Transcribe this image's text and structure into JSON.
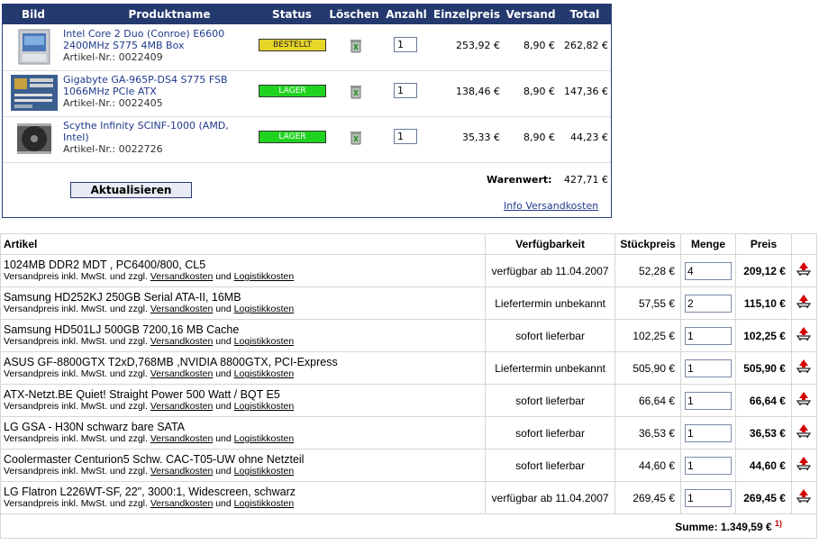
{
  "cart1": {
    "headers": [
      "Bild",
      "Produktname",
      "Status",
      "Löschen",
      "Anzahl",
      "Einzelpreis",
      "Versand",
      "Total"
    ],
    "rows": [
      {
        "name": "Intel Core 2 Duo (Conroe) E6600 2400MHz S775 4MB Box",
        "artnr": "Artikel-Nr.: 0022409",
        "status": "BESTELLT",
        "qty": "1",
        "price": "253,92 €",
        "shipping": "8,90 €",
        "total": "262,82 €"
      },
      {
        "name": "Gigabyte GA-965P-DS4 S775 FSB 1066MHz PCIe ATX",
        "artnr": "Artikel-Nr.: 0022405",
        "status": "LAGER",
        "qty": "1",
        "price": "138,46 €",
        "shipping": "8,90 €",
        "total": "147,36 €"
      },
      {
        "name": "Scythe Infinity SCINF-1000 (AMD, Intel)",
        "artnr": "Artikel-Nr.: 0022726",
        "status": "LAGER",
        "qty": "1",
        "price": "35,33 €",
        "shipping": "8,90 €",
        "total": "44,23 €"
      }
    ],
    "warenwert_label": "Warenwert:",
    "warenwert_value": "427,71 €",
    "update_button": "Aktualisieren",
    "info_link": "Info Versandkosten",
    "colors": {
      "header": "#24396e",
      "bestellt": "#e8d52a",
      "lager": "#21d321",
      "link": "#1f3a8a"
    }
  },
  "cart2": {
    "headers": [
      "Artikel",
      "Verfügbarkeit",
      "Stückpreis",
      "Menge",
      "Preis"
    ],
    "note": {
      "prefix": "Versandpreis inkl. MwSt. und zzgl.",
      "link1": "Versandkosten",
      "middle": "und",
      "link2": "Logistikkosten"
    },
    "rows": [
      {
        "name": "1024MB DDR2 MDT , PC6400/800, CL5",
        "avail": "verfügbar ab 11.04.2007",
        "unit": "52,28 €",
        "qty": "4",
        "total": "209,12 €"
      },
      {
        "name": "Samsung HD252KJ 250GB Serial ATA-II, 16MB",
        "avail": "Liefertermin unbekannt",
        "unit": "57,55 €",
        "qty": "2",
        "total": "115,10 €"
      },
      {
        "name": "Samsung HD501LJ 500GB 7200,16 MB Cache",
        "avail": "sofort lieferbar",
        "unit": "102,25 €",
        "qty": "1",
        "total": "102,25 €"
      },
      {
        "name": "ASUS GF-8800GTX T2xD,768MB ,NVIDIA 8800GTX, PCI-Express",
        "avail": "Liefertermin unbekannt",
        "unit": "505,90 €",
        "qty": "1",
        "total": "505,90 €"
      },
      {
        "name": "ATX-Netzt.BE Quiet! Straight Power 500 Watt / BQT E5",
        "avail": "sofort lieferbar",
        "unit": "66,64 €",
        "qty": "1",
        "total": "66,64 €"
      },
      {
        "name": "LG GSA - H30N schwarz bare SATA",
        "avail": "sofort lieferbar",
        "unit": "36,53 €",
        "qty": "1",
        "total": "36,53 €"
      },
      {
        "name": "Coolermaster Centurion5 Schw. CAC-T05-UW ohne Netzteil",
        "avail": "sofort lieferbar",
        "unit": "44,60 €",
        "qty": "1",
        "total": "44,60 €"
      },
      {
        "name": "LG Flatron L226WT-SF, 22\", 3000:1, Widescreen, schwarz",
        "avail": "verfügbar ab 11.04.2007",
        "unit": "269,45 €",
        "qty": "1",
        "total": "269,45 €"
      }
    ],
    "sum_label": "Summe: 1.349,59 €",
    "sum_footnote": "1)",
    "delete_icon": "cart-remove-icon"
  }
}
